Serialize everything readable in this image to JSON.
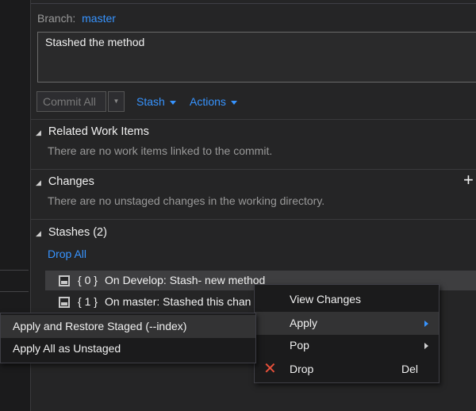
{
  "branch": {
    "label": "Branch:",
    "name": "master"
  },
  "commit_message": "Stashed the method",
  "toolbar": {
    "commit_all": "Commit All",
    "commit_dropdown_icon": "chevron-down-icon",
    "stash": "Stash",
    "actions": "Actions"
  },
  "sections": {
    "related_work_items": {
      "title": "Related Work Items",
      "text": "There are no work items linked to the commit."
    },
    "changes": {
      "title": "Changes",
      "text": "There are no unstaged changes in the working directory.",
      "add_icon": "plus-icon"
    },
    "stashes": {
      "title": "Stashes (2)",
      "drop_all": "Drop All"
    }
  },
  "stash_items": [
    {
      "index": "{ 0 }",
      "text": "On Develop: Stash- new method"
    },
    {
      "index": "{ 1 }",
      "text": "On master: Stashed this chan"
    }
  ],
  "context_menu": {
    "items": [
      {
        "label": "View Changes"
      },
      {
        "label": "Apply"
      },
      {
        "label": "Pop"
      },
      {
        "label": "Drop",
        "shortcut": "Del",
        "icon": "x-icon"
      }
    ]
  },
  "submenu": {
    "items": [
      {
        "label": "Apply and Restore Staged (--index)"
      },
      {
        "label": "Apply All as Unstaged"
      }
    ]
  },
  "colors": {
    "link": "#3794ff",
    "drop_icon": "#e8503a",
    "background": "#252526"
  }
}
